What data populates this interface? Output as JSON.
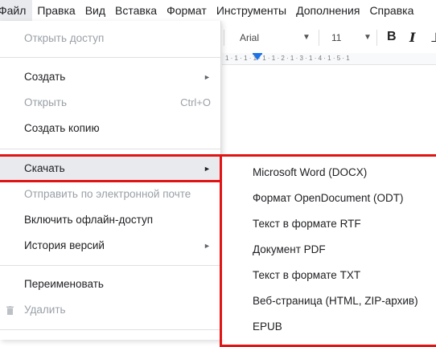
{
  "menubar": {
    "items": [
      "Файл",
      "Правка",
      "Вид",
      "Вставка",
      "Формат",
      "Инструменты",
      "Дополнения",
      "Справка"
    ]
  },
  "toolbar": {
    "font": "Arial",
    "size": "11",
    "bold": "B",
    "italic": "I",
    "ruler_text": "1 · 1 · 1 · 1 · 1 · 1 · 2 · 1 · 3 · 1 · 4 · 1 · 5 · 1"
  },
  "file_menu": {
    "items": [
      {
        "label": "Открыть доступ",
        "disabled": true
      },
      {
        "label": "Создать",
        "submenu": true
      },
      {
        "label": "Открыть",
        "disabled": true,
        "shortcut": "Ctrl+O"
      },
      {
        "label": "Создать копию"
      },
      {
        "label": "Скачать",
        "submenu": true,
        "highlighted": true
      },
      {
        "label": "Отправить по электронной почте",
        "disabled": true
      },
      {
        "label": "Включить офлайн-доступ"
      },
      {
        "label": "История версий",
        "submenu": true
      },
      {
        "label": "Переименовать"
      },
      {
        "label": "Удалить",
        "disabled": true,
        "icon": "trash-icon"
      }
    ]
  },
  "download_submenu": {
    "items": [
      "Microsoft Word (DOCX)",
      "Формат OpenDocument (ODT)",
      "Текст в формате RTF",
      "Документ PDF",
      "Текст в формате TXT",
      "Веб-страница (HTML, ZIP-архив)",
      "EPUB"
    ]
  },
  "colors": {
    "highlight_border": "#e01414",
    "menu_hover": "#e8eaed",
    "disabled_text": "#9aa0a6",
    "ruler_marker": "#1a73e8"
  }
}
